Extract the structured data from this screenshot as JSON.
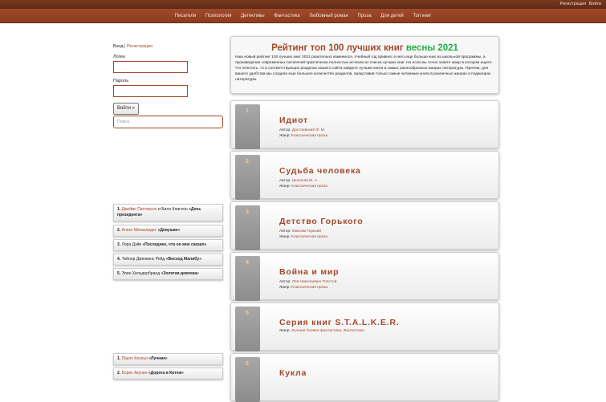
{
  "topbar": {
    "register": "Регистрация",
    "login": "Войти"
  },
  "nav": [
    "Писатели",
    "Психология",
    "Детективы",
    "Фантастика",
    "Любовный роман",
    "Проза",
    "Для детей",
    "Топ книг"
  ],
  "sidebar": {
    "login_label": "Вход",
    "sep": "|",
    "register_label": "Регистрация",
    "login_field": "Логин",
    "password_field": "Пароль",
    "login_button": "Войти »",
    "search_placeholder": "Поиск"
  },
  "list1": [
    {
      "n": "1.",
      "author": "Джеймс Паттерсон",
      "mid": "и Билл Клинтон",
      "title": "«Дочь президента»"
    },
    {
      "n": "2.",
      "author": "Алекс Михаэлидес",
      "mid": "",
      "title": "«Девушки»"
    },
    {
      "n": "3.",
      "author": "",
      "mid": "Лора Дэйв",
      "title": "«Последнее, что он мне сказал»"
    },
    {
      "n": "4.",
      "author": "",
      "mid": "Тейлор Дженкинс Рейд",
      "title": "«Восход Малибу»"
    },
    {
      "n": "5.",
      "author": "",
      "mid": "Элин Хильдербранд",
      "title": "«Золотая девочка»"
    }
  ],
  "list2": [
    {
      "n": "1.",
      "author": "Пауло Коэльо",
      "mid": "",
      "title": "«Лучник»"
    },
    {
      "n": "2.",
      "author": "Борис Акунин",
      "mid": "",
      "title": "«Дорога в Китеж»"
    }
  ],
  "intro": {
    "title": "Рейтинг топ 100 лучших книг",
    "title_green": "весны 2021",
    "text": "Наш новый рейтинг 100 лучших книг 2021 разительно изменился. Учебный год привнес в него еще больше книг из школьной программы, а произведения современных писателей практически полностью исчезли из списка лучших книг. Но если вы точно знаете жанр в котором ищете что почитать, то в соответствующих разделах нашего сайта найдете лучшие книги в самых разнообразных жанрах литературы. Причем, для вашего удобства мы создали еще большее количество разделов, представив только самые читаемые книги в различных жанрах и поджанрах литературы."
  },
  "books": [
    {
      "num": "1",
      "title": "Идиот",
      "author_label": "Автор:",
      "author": "Достоевский Ф. М.",
      "genre_label": "Жанр:",
      "genre": "Классическая проза"
    },
    {
      "num": "2",
      "title": "Судьба человека",
      "author_label": "Автор:",
      "author": "Шолохов М. А.",
      "genre_label": "Жанр:",
      "genre": "Классическая проза"
    },
    {
      "num": "3",
      "title": "Детство Горького",
      "author_label": "Автор:",
      "author": "Максим Горький",
      "genre_label": "Жанр:",
      "genre": "Классическая проза"
    },
    {
      "num": "4",
      "title": "Война и мир",
      "author_label": "Автор:",
      "author": "Лев Николаевич Толстой",
      "genre_label": "Жанр:",
      "genre": "Классическая проза"
    },
    {
      "num": "5",
      "title": "Серия книг S.T.A.L.K.E.R.",
      "genre_label": "Жанр:",
      "genre": "Лучшая боевая фантастика, Фантастика"
    },
    {
      "num": "6",
      "title": "Кукла"
    }
  ]
}
